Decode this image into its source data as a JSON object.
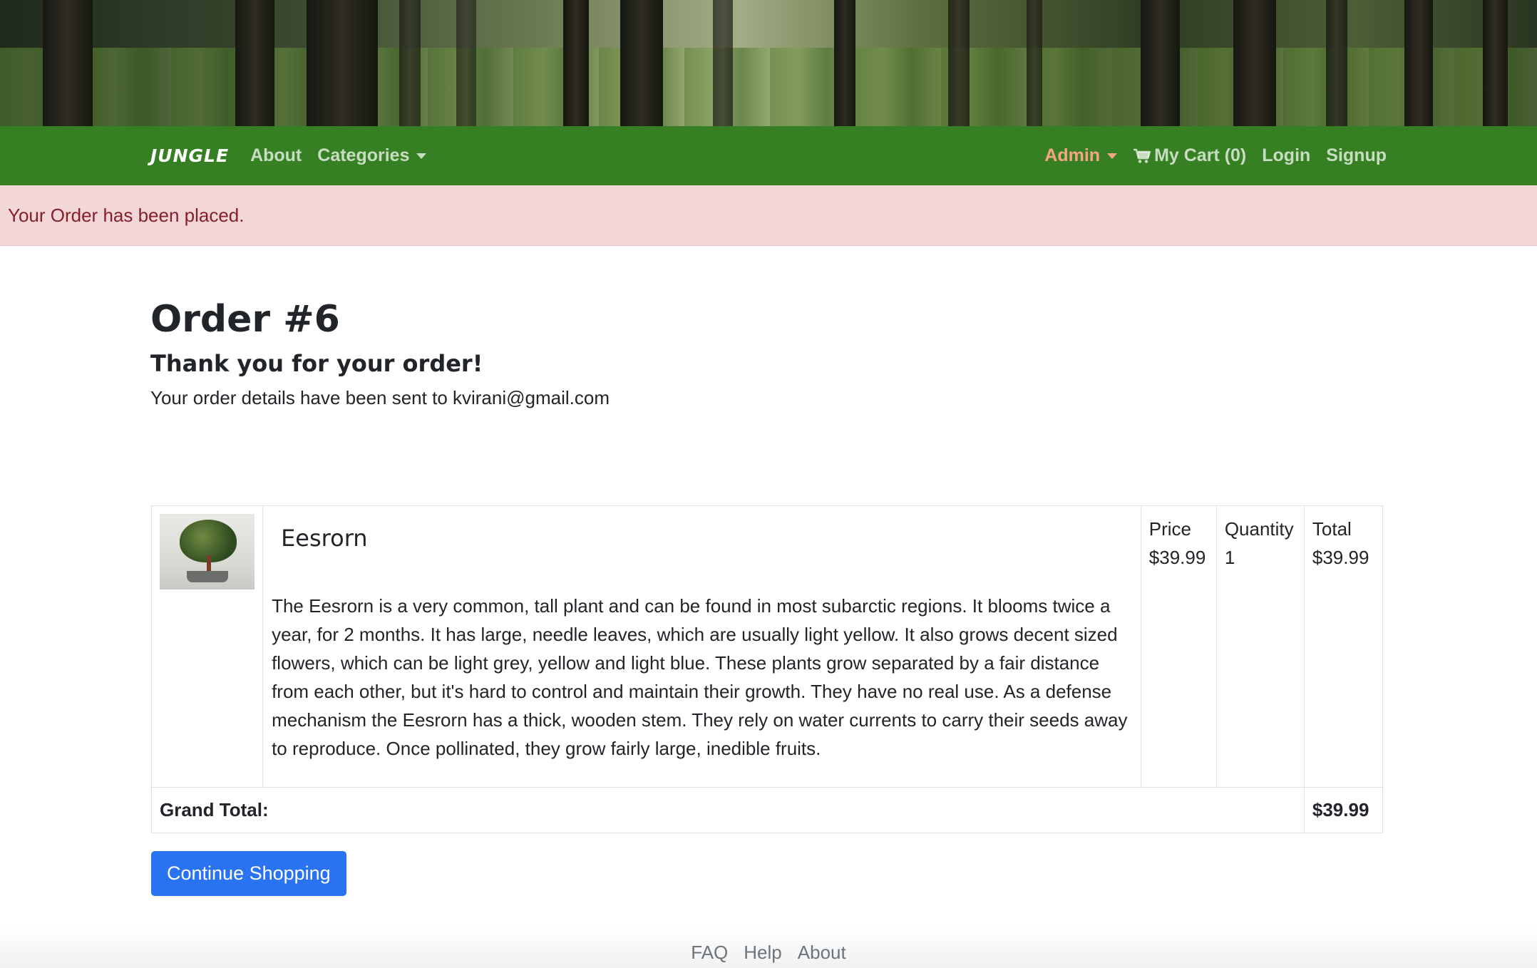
{
  "navbar": {
    "brand": "JUNGLE",
    "about": "About",
    "categories": "Categories",
    "admin": "Admin",
    "cart": "My Cart (0)",
    "login": "Login",
    "signup": "Signup"
  },
  "alert": {
    "message": "Your Order has been placed."
  },
  "order": {
    "title": "Order #6",
    "thanks": "Thank you for your order!",
    "sent_text": "Your order details have been sent to kvirani@gmail.com"
  },
  "line_item": {
    "name": "Eesrorn",
    "description": "The Eesrorn is a very common, tall plant and can be found in most subarctic regions. It blooms twice a year, for 2 months. It has large, needle leaves, which are usually light yellow. It also grows decent sized flowers, which can be light grey, yellow and light blue. These plants grow separated by a fair distance from each other, but it's hard to control and maintain their growth. They have no real use. As a defense mechanism the Eesrorn has a thick, wooden stem. They rely on water currents to carry their seeds away to reproduce. Once pollinated, they grow fairly large, inedible fruits.",
    "price_label": "Price",
    "price": "$39.99",
    "quantity_label": "Quantity",
    "quantity": "1",
    "total_label": "Total",
    "total": "$39.99"
  },
  "grand_total": {
    "label": "Grand Total:",
    "value": "$39.99"
  },
  "continue_button": "Continue Shopping",
  "footer": {
    "faq": "FAQ",
    "help": "Help",
    "about": "About"
  }
}
